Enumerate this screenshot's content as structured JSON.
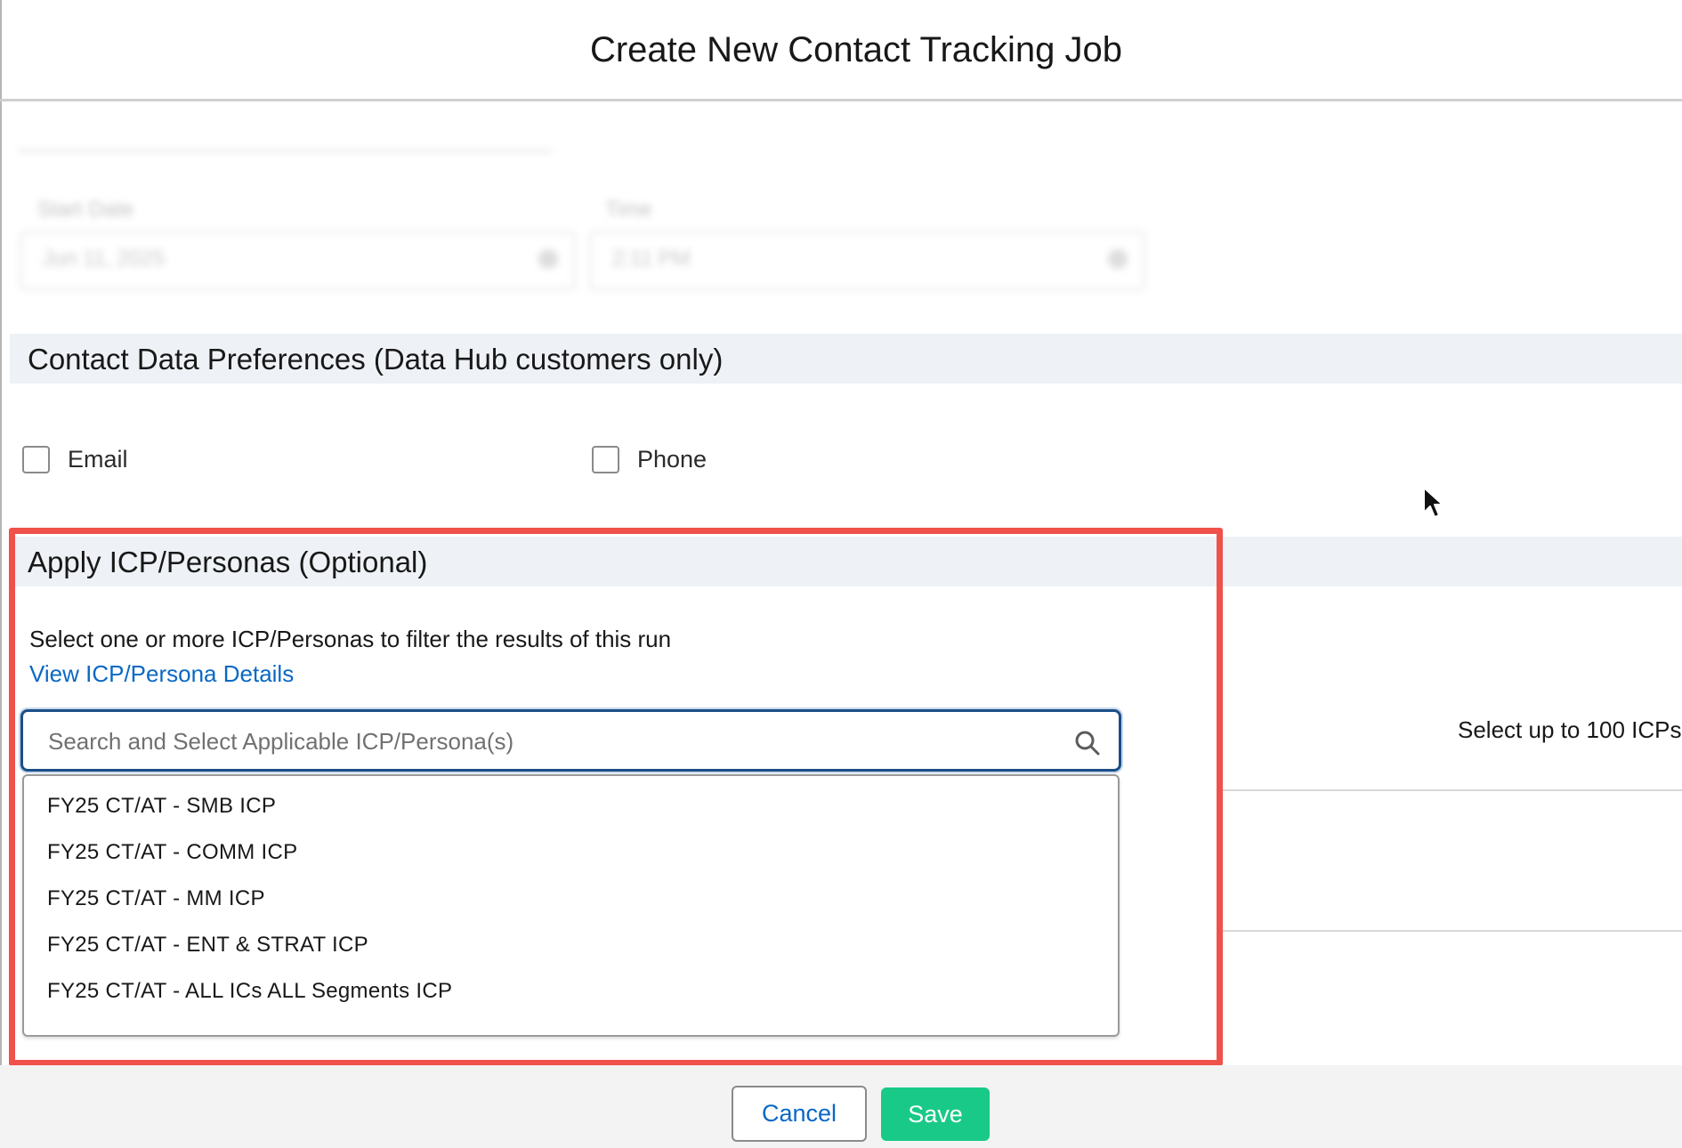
{
  "modal": {
    "title": "Create New Contact Tracking Job"
  },
  "schedule": {
    "start_date_label": "Start Date",
    "start_date_value": "Jun 11, 2025",
    "time_label": "Time",
    "time_value": "2:11 PM"
  },
  "contact_prefs": {
    "title": "Contact Data Preferences (Data Hub customers only)",
    "email_label": "Email",
    "phone_label": "Phone"
  },
  "icp": {
    "title": "Apply ICP/Personas (Optional)",
    "help_text": "Select one or more ICP/Personas to filter the results of this run",
    "details_link": "View ICP/Persona Details",
    "search_placeholder": "Search and Select Applicable ICP/Persona(s)",
    "limit_note": "Select up to 100 ICPs",
    "options": [
      "FY25 CT/AT - SMB ICP",
      "FY25 CT/AT - COMM ICP",
      "FY25 CT/AT - MM ICP",
      "FY25 CT/AT - ENT & STRAT ICP",
      "FY25 CT/AT - ALL ICs ALL Segments ICP"
    ]
  },
  "footer": {
    "cancel_label": "Cancel",
    "save_label": "Save"
  },
  "colors": {
    "highlight": "#f0514b",
    "save": "#19c987",
    "link": "#0a68c4",
    "focus": "#1b4e86"
  }
}
